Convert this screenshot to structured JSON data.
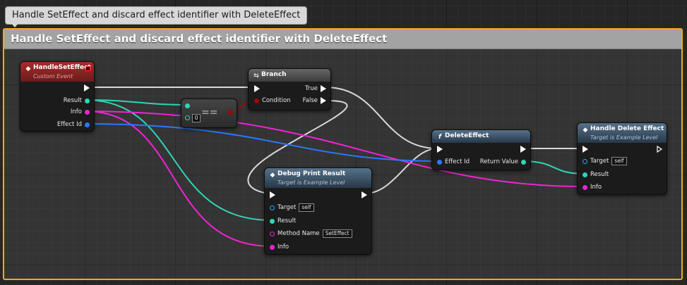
{
  "tooltip": {
    "text": "Handle SetEffect and discard effect identifier with DeleteEffect"
  },
  "comment": {
    "title": "Handle SetEffect and discard effect identifier with DeleteEffect"
  },
  "colors": {
    "exec": "#ffffff",
    "struct": "#2fd6b5",
    "string": "#f222d6",
    "int": "#2b78ff",
    "bool": "#9a0a0a",
    "object": "#1ea7ff",
    "comment_border": "#f4a91c",
    "wire": "#d8d8d8"
  },
  "nodes": {
    "handle_set_effect": {
      "icon": "event-diamond-icon",
      "title": "HandleSetEffect",
      "subtitle": "Custom Event",
      "pins": {
        "result": "Result",
        "info": "Info",
        "effect_id": "Effect Id"
      }
    },
    "equals": {
      "symbol": "==",
      "value": "0"
    },
    "branch": {
      "title": "Branch",
      "pins": {
        "condition": "Condition",
        "true": "True",
        "false": "False"
      }
    },
    "debug_print": {
      "title": "Debug Print Result",
      "subtitle": "Target is Example Level",
      "pins": {
        "target": "Target",
        "target_value": "self",
        "result": "Result",
        "method_name": "Method Name",
        "method_value": "SetEffect",
        "info": "Info"
      }
    },
    "delete_effect": {
      "icon": "function-f-icon",
      "title": "DeleteEffect",
      "pins": {
        "effect_id": "Effect Id",
        "return_value": "Return Value"
      }
    },
    "handle_delete_effect": {
      "title": "Handle Delete Effect",
      "subtitle": "Target is Example Level",
      "pins": {
        "target": "Target",
        "target_value": "self",
        "result": "Result",
        "info": "Info"
      }
    }
  }
}
